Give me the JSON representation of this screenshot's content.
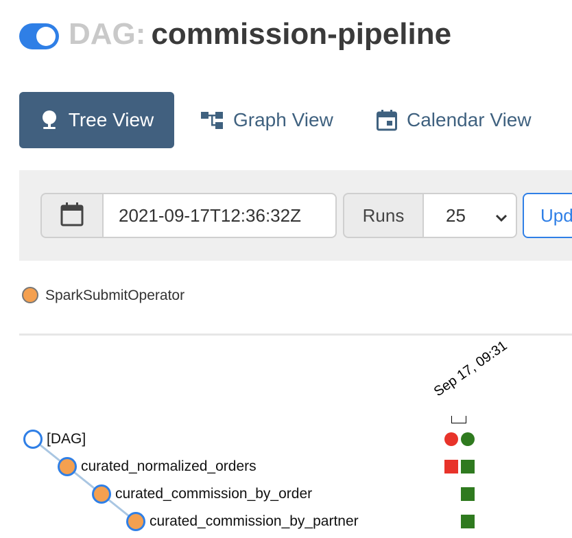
{
  "header": {
    "paused_toggle": "on",
    "title_prefix": "DAG:",
    "dag_id": "commission-pipeline"
  },
  "tabs": [
    {
      "label": "Tree View",
      "icon": "tree-icon",
      "active": true
    },
    {
      "label": "Graph View",
      "icon": "graph-icon",
      "active": false
    },
    {
      "label": "Calendar View",
      "icon": "calendar-icon",
      "active": false
    }
  ],
  "form": {
    "base_date": "2021-09-17T12:36:32Z",
    "runs_label": "Runs",
    "runs_value": "25",
    "update_label": "Update"
  },
  "legend": [
    {
      "label": "SparkSubmitOperator",
      "color": "#f4a050"
    }
  ],
  "tree": {
    "run_date_label": "Sep 17, 09:31",
    "nodes": [
      {
        "label": "[DAG]",
        "type": "dag"
      },
      {
        "label": "curated_normalized_orders",
        "type": "task"
      },
      {
        "label": "curated_commission_by_order",
        "type": "task"
      },
      {
        "label": "curated_commission_by_partner",
        "type": "task"
      }
    ],
    "dag_runs": [
      {
        "state": "failed",
        "color": "#e8332a"
      },
      {
        "state": "success",
        "color": "#2f7a1f"
      }
    ],
    "task_instances": [
      [
        {
          "state": "failed",
          "color": "#e8332a"
        },
        {
          "state": "success",
          "color": "#2f7a1f"
        }
      ],
      [
        {
          "state": "none"
        },
        {
          "state": "success",
          "color": "#2f7a1f"
        }
      ],
      [
        {
          "state": "none"
        },
        {
          "state": "success",
          "color": "#2f7a1f"
        }
      ]
    ]
  },
  "colors": {
    "accent": "#2f7fe6",
    "tab_active_bg": "#41607f",
    "operator_orange": "#f4a050",
    "failed_red": "#e8332a",
    "success_green": "#2f7a1f"
  }
}
